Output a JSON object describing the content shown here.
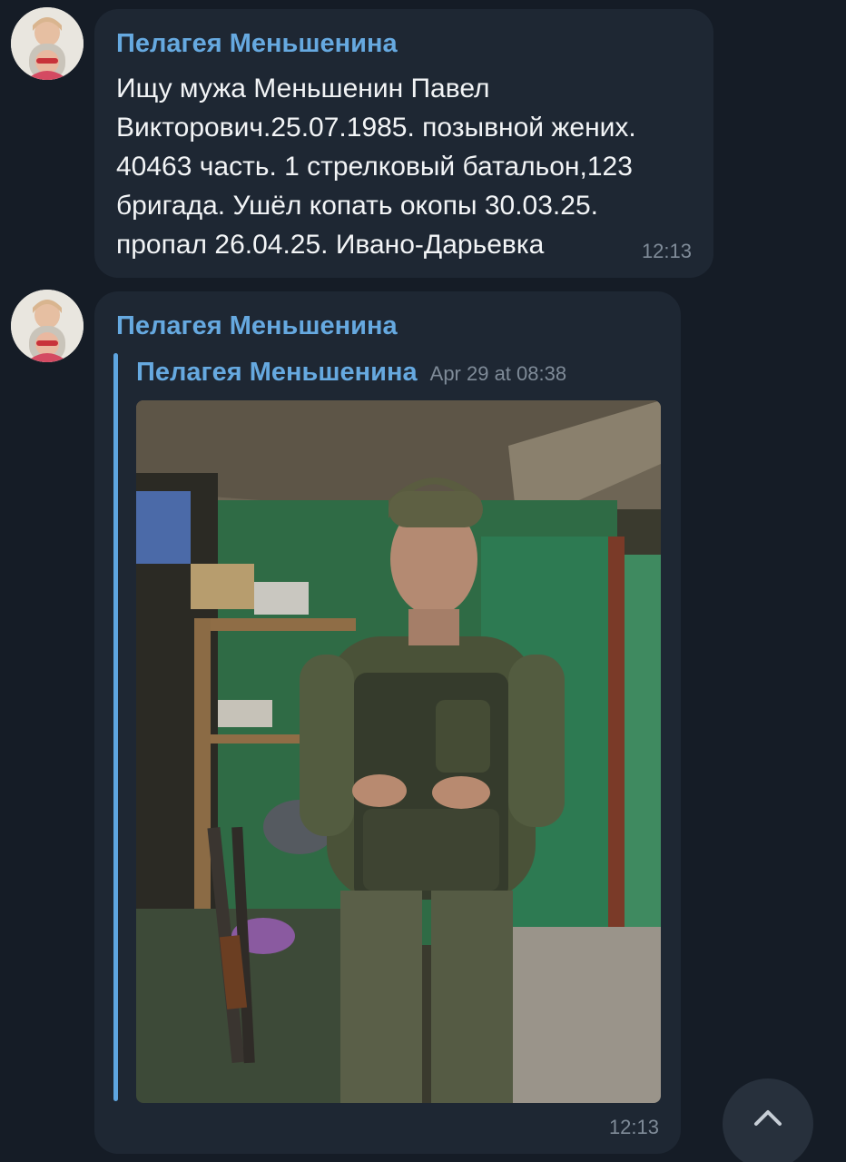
{
  "messages": [
    {
      "sender": "Пелагея Меньшенина",
      "text_lines": [
        "Ищу мужа Меньшенин Павел",
        "Викторович.25.07.1985. позывной жених.",
        "40463 часть. 1 стрелковый батальон,123",
        "бригада. Ушёл копать окопы 30.03.25.",
        "пропал 26.04.25. Ивано-Дарьевка"
      ],
      "time": "12:13"
    },
    {
      "sender": "Пелагея Меньшенина",
      "forwarded": {
        "sender": "Пелагея Меньшенина",
        "date": "Apr 29 at 08:38",
        "media": "photo"
      },
      "time": "12:13"
    }
  ],
  "icons": {
    "scroll_down": "chevron-up-icon"
  },
  "colors": {
    "background": "#151c26",
    "bubble": "#1e2733",
    "accent": "#66a9e0",
    "text": "#f2f4f6",
    "meta": "#7f8b98"
  }
}
